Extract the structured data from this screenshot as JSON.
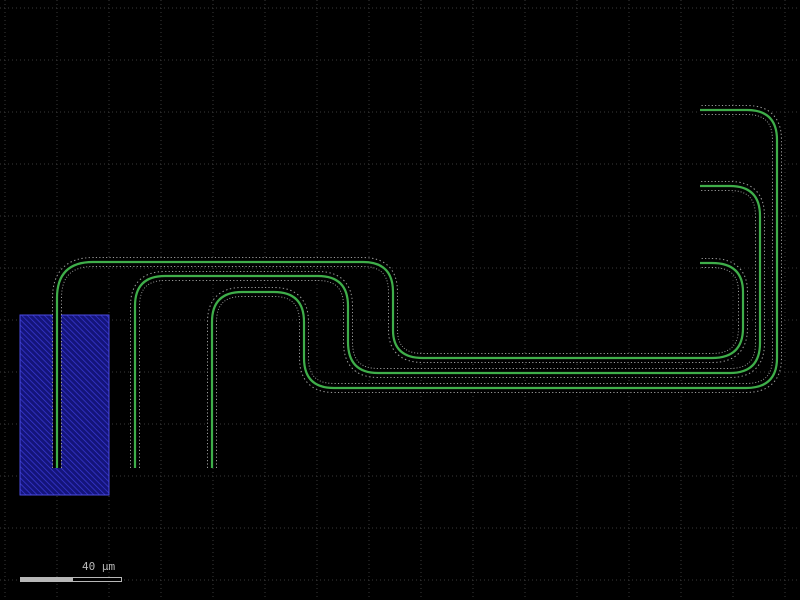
{
  "viewer": {
    "background_color": "#000000",
    "grid_color": "#3a3a3a",
    "scale_label": "40 µm"
  },
  "layers": {
    "waveguide_core_color": "#3fae4a",
    "waveguide_cladding_color": "#9a9a9a",
    "pad_fill_color": "#1a1a8a",
    "pad_hatch_color": "#3a3ad8"
  },
  "components": [
    {
      "name": "metal-pad"
    },
    {
      "name": "waveguide-route-1"
    },
    {
      "name": "waveguide-route-2"
    },
    {
      "name": "waveguide-route-3"
    }
  ]
}
